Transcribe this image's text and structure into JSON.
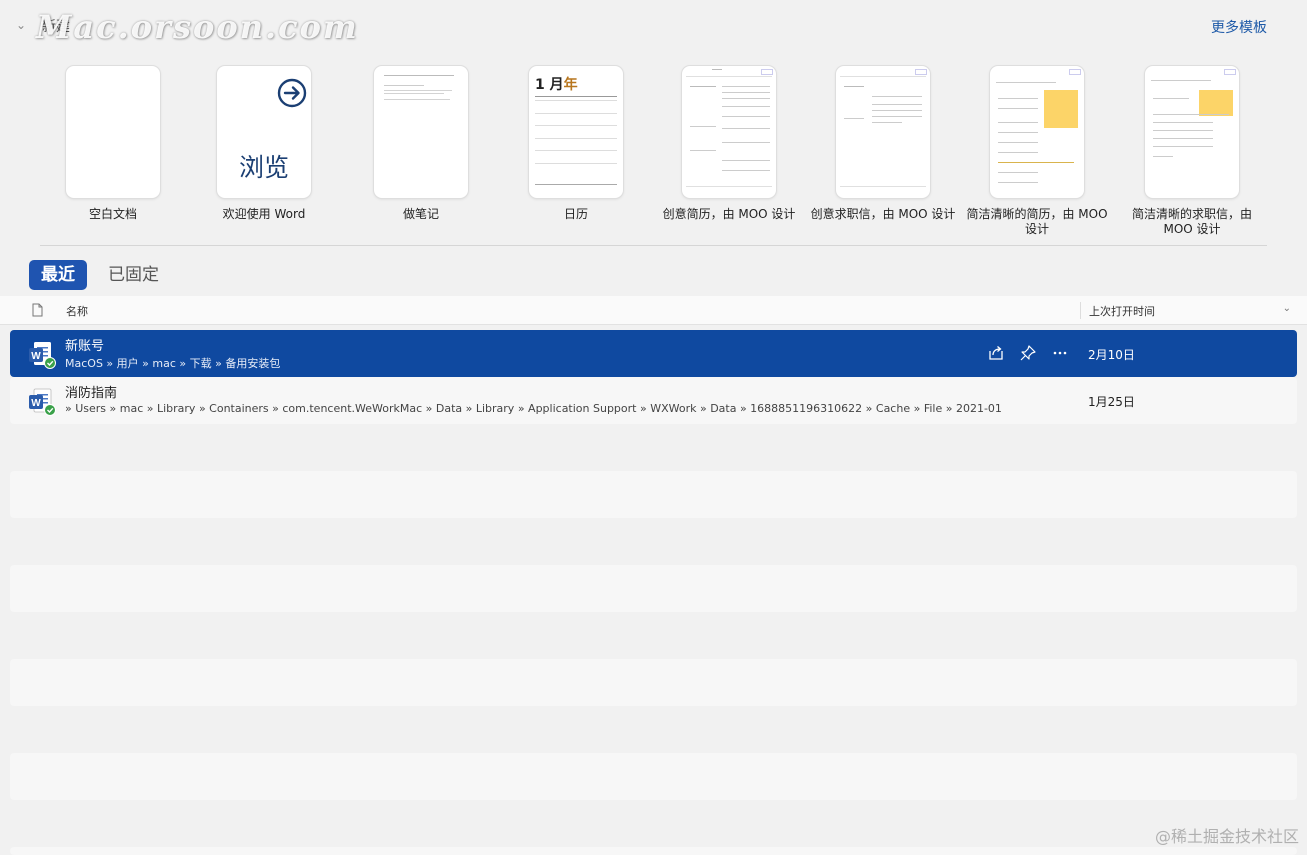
{
  "header": {
    "title": "新建",
    "watermark": "Mac.orsoon.com",
    "more_templates": "更多模板"
  },
  "templates": [
    {
      "label": "空白文档"
    },
    {
      "label": "欢迎使用 Word",
      "browse_text": "浏览"
    },
    {
      "label": "做笔记"
    },
    {
      "label": "日历",
      "month": "1 月",
      "year_char": "年"
    },
    {
      "label": "创意简历，由 MOO 设计"
    },
    {
      "label": "创意求职信，由 MOO 设计"
    },
    {
      "label": "简洁清晰的简历，由 MOO 设计"
    },
    {
      "label": "简洁清晰的求职信，由 MOO 设计"
    }
  ],
  "tabs": {
    "recent": "最近",
    "pinned": "已固定"
  },
  "table": {
    "col_name": "名称",
    "col_date": "上次打开时间"
  },
  "files": [
    {
      "name": "新账号",
      "path": "MacOS » 用户 » mac » 下载 » 备用安装包",
      "date": "2月10日",
      "selected": true
    },
    {
      "name": "消防指南",
      "path": " » Users » mac » Library » Containers » com.tencent.WeWorkMac » Data » Library » Application Support » WXWork » Data » 1688851196310622 » Cache » File » 2021-01",
      "date": "1月25日",
      "selected": false
    }
  ],
  "footer_mark": "@稀土掘金技术社区",
  "colors": {
    "accent": "#1f54b0",
    "selected_row": "#0f49a0",
    "link": "#1e5aa8",
    "background": "#f1f1f1"
  }
}
